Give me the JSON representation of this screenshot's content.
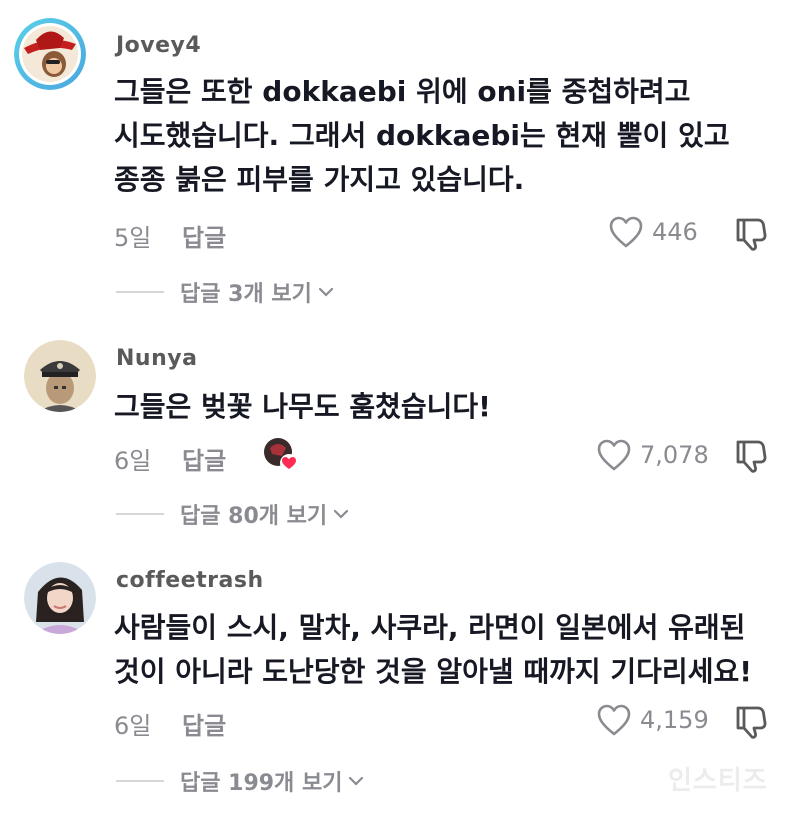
{
  "comments": [
    {
      "username": "Jovey4",
      "text": "그들은 또한 dokkaebi 위에 oni를 중첩하려고 시도했습니다. 그래서 dokkaebi는 현재 뿔이 있고 종종 붉은 피부를 가지고 있습니다.",
      "time": "5일",
      "reply_label": "답글",
      "likes": "446",
      "view_replies": "답글 3개 보기"
    },
    {
      "username": "Nunya",
      "text": "그들은 벚꽃 나무도 훔쳤습니다!",
      "time": "6일",
      "reply_label": "답글",
      "likes": "7,078",
      "view_replies": "답글 80개 보기"
    },
    {
      "username": "coffeetrash",
      "text": "사람들이 스시, 말차, 사쿠라, 라면이 일본에서 유래된 것이 아니라 도난당한 것을 알아낼 때까지 기다리세요!",
      "time": "6일",
      "reply_label": "답글",
      "likes": "4,159",
      "view_replies": "답글 199개 보기"
    }
  ],
  "watermark": "인스티즈",
  "icons": {
    "like": "heart-outline-icon",
    "dislike": "thumbs-down-icon",
    "chevron": "chevron-down-icon",
    "creator_liked": "creator-liked-heart-icon"
  },
  "colors": {
    "text": "#161823",
    "muted": "#8a8b91",
    "creator_heart": "#fe2c55"
  }
}
